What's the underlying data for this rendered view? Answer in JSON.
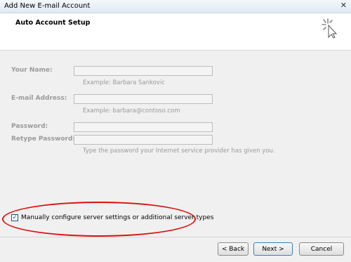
{
  "window": {
    "title": "Add New E-mail Account"
  },
  "header": {
    "title": "Auto Account Setup"
  },
  "form": {
    "your_name": {
      "label": "Your Name:",
      "value": "",
      "hint": "Example: Barbara Sankovic"
    },
    "email": {
      "label": "E-mail Address:",
      "value": "",
      "hint": "Example: barbara@contoso.com"
    },
    "password": {
      "label": "Password:",
      "value": ""
    },
    "retype_password": {
      "label": "Retype Password:",
      "value": "",
      "hint": "Type the password your Internet service provider has given you."
    }
  },
  "manual_config": {
    "label": "Manually configure server settings or additional server types",
    "checked": true
  },
  "buttons": {
    "back": "< Back",
    "next": "Next >",
    "cancel": "Cancel"
  },
  "annotation_color": "#e01010"
}
